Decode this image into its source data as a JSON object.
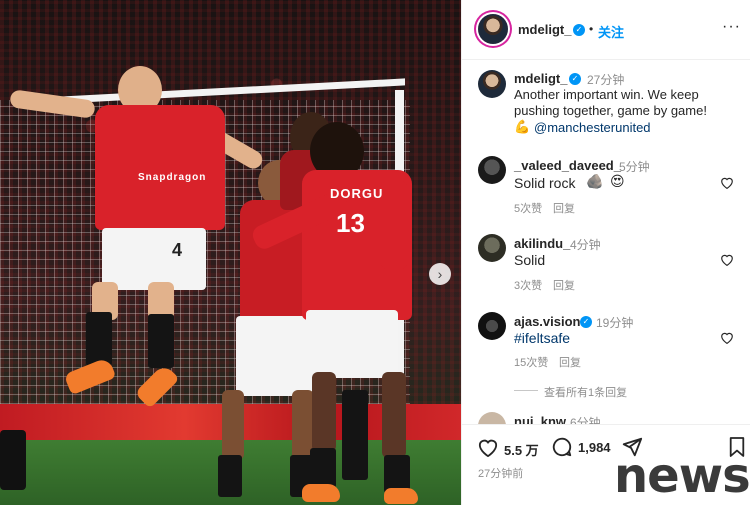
{
  "post": {
    "author": "mdeligt_",
    "follow_label": "关注",
    "separator": "•",
    "more_label": "···",
    "caption_time": "27分钟",
    "caption_line1": "Another important win. We keep",
    "caption_line2": "pushing together, game by game!",
    "caption_mention": "@manchesterunited",
    "likes": "5.5 万",
    "comments_count": "1,984",
    "posted_ago": "27分钟前"
  },
  "photo": {
    "jersey_name": "DORGU",
    "jersey_number_1": "4",
    "jersey_number_2": "13",
    "sponsor": "Snapdragon"
  },
  "comments": [
    {
      "user": "_valeed_daveed_",
      "time": "5分钟",
      "text": "Solid rock",
      "likes": "5次赞",
      "reply": "回复"
    },
    {
      "user": "akilindu_",
      "time": "4分钟",
      "text": "Solid",
      "likes": "3次赞",
      "reply": "回复"
    },
    {
      "user": "ajas.vision",
      "time": "19分钟",
      "text": "#ifeltsafe",
      "likes": "15次赞",
      "reply": "回复"
    },
    {
      "user": "nui_knw",
      "time": "6分钟"
    }
  ],
  "view_replies": "查看所有1条回复",
  "watermark": "news",
  "colors": {
    "accent": "#0095f6",
    "united_red": "#d9222a",
    "link": "#00376b"
  }
}
